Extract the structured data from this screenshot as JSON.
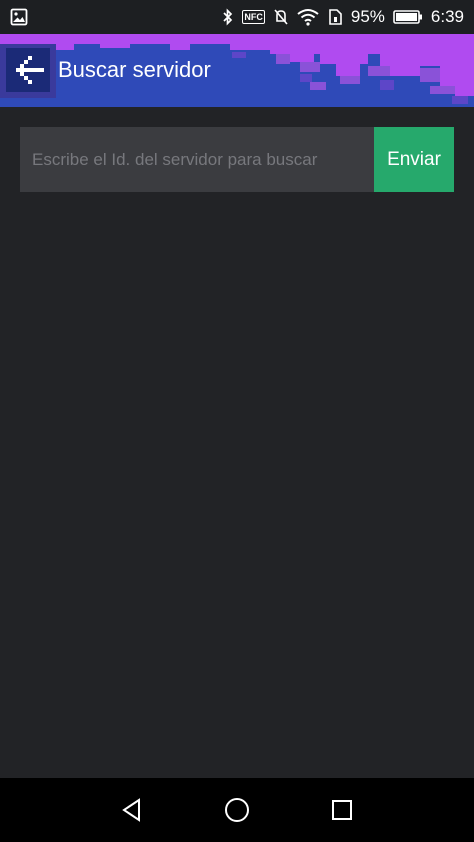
{
  "status_bar": {
    "battery_percent": "95%",
    "time": "6:39",
    "nfc_label": "NFC",
    "icons": [
      "gallery-icon",
      "bluetooth-icon",
      "nfc-icon",
      "mute-icon",
      "wifi-icon",
      "sim-icon",
      "battery-icon"
    ]
  },
  "app_bar": {
    "title": "Buscar servidor",
    "back_icon": "back-arrow-icon",
    "colors": {
      "background": "#2f4ab8",
      "pixel_accent": "#b04bf0"
    }
  },
  "search": {
    "placeholder": "Escribe el Id. del servidor para buscar",
    "value": "",
    "submit_label": "Enviar",
    "submit_color": "#26a96c"
  },
  "nav_bar": {
    "buttons": [
      "back-triangle-icon",
      "home-circle-icon",
      "recents-square-icon"
    ]
  }
}
